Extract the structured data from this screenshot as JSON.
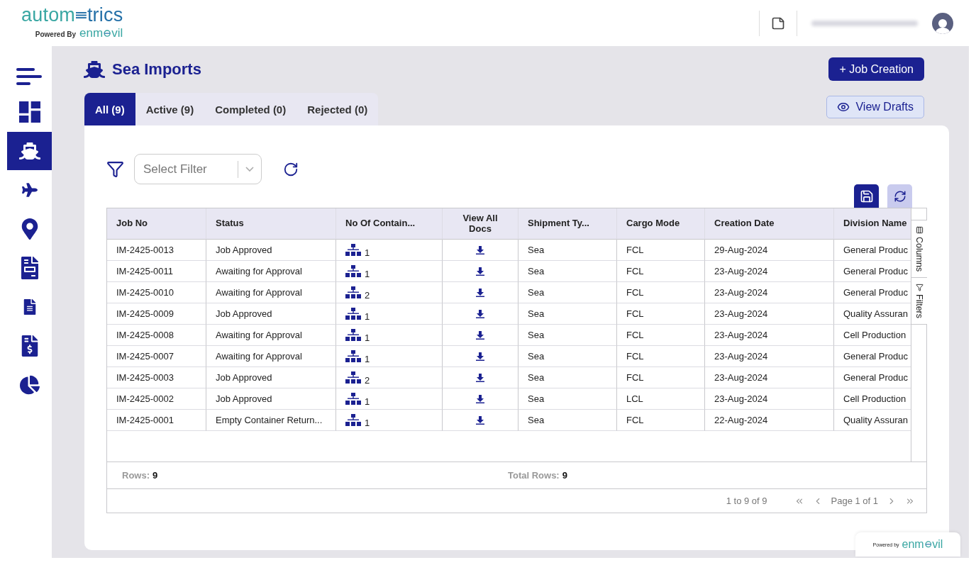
{
  "header": {
    "logo": {
      "left": "autom",
      "right": "trics"
    },
    "powered_by": {
      "label": "Powered By",
      "brand_left": "enm",
      "brand_right": "vil"
    }
  },
  "sidebar": {
    "items": [
      {
        "kind": "dashboard",
        "selected": false
      },
      {
        "kind": "ship",
        "selected": true
      },
      {
        "kind": "plane",
        "selected": false
      },
      {
        "kind": "pin",
        "selected": false
      },
      {
        "kind": "sheet",
        "selected": false
      },
      {
        "kind": "document",
        "selected": false
      },
      {
        "kind": "invoice",
        "selected": false
      },
      {
        "kind": "report",
        "selected": false
      }
    ]
  },
  "page": {
    "title": "Sea Imports",
    "job_creation": "+ Job Creation",
    "view_drafts": "View Drafts"
  },
  "tabs": [
    {
      "label": "All (9)",
      "selected": true
    },
    {
      "label": "Active (9)",
      "selected": false
    },
    {
      "label": "Completed (0)",
      "selected": false
    },
    {
      "label": "Rejected (0)",
      "selected": false
    }
  ],
  "filter": {
    "placeholder": "Select Filter"
  },
  "table": {
    "columns": [
      "Job No",
      "Status",
      "No Of Contain...",
      "View All Docs",
      "Shipment Ty...",
      "Cargo Mode",
      "Creation Date",
      "Division Name"
    ],
    "rows": [
      {
        "job_no": "IM-2425-0013",
        "status": "Job Approved",
        "containers": "1",
        "shipment_type": "Sea",
        "cargo_mode": "FCL",
        "creation_date": "29-Aug-2024",
        "division": "General Produc"
      },
      {
        "job_no": "IM-2425-0011",
        "status": "Awaiting for Approval",
        "containers": "1",
        "shipment_type": "Sea",
        "cargo_mode": "FCL",
        "creation_date": "23-Aug-2024",
        "division": "General Produc"
      },
      {
        "job_no": "IM-2425-0010",
        "status": "Awaiting for Approval",
        "containers": "2",
        "shipment_type": "Sea",
        "cargo_mode": "FCL",
        "creation_date": "23-Aug-2024",
        "division": "General Produc"
      },
      {
        "job_no": "IM-2425-0009",
        "status": "Job Approved",
        "containers": "1",
        "shipment_type": "Sea",
        "cargo_mode": "FCL",
        "creation_date": "23-Aug-2024",
        "division": "Quality Assuran"
      },
      {
        "job_no": "IM-2425-0008",
        "status": "Awaiting for Approval",
        "containers": "1",
        "shipment_type": "Sea",
        "cargo_mode": "FCL",
        "creation_date": "23-Aug-2024",
        "division": "Cell Production"
      },
      {
        "job_no": "IM-2425-0007",
        "status": "Awaiting for Approval",
        "containers": "1",
        "shipment_type": "Sea",
        "cargo_mode": "FCL",
        "creation_date": "23-Aug-2024",
        "division": "General Produc"
      },
      {
        "job_no": "IM-2425-0003",
        "status": "Job Approved",
        "containers": "2",
        "shipment_type": "Sea",
        "cargo_mode": "FCL",
        "creation_date": "23-Aug-2024",
        "division": "General Produc"
      },
      {
        "job_no": "IM-2425-0002",
        "status": "Job Approved",
        "containers": "1",
        "shipment_type": "Sea",
        "cargo_mode": "LCL",
        "creation_date": "23-Aug-2024",
        "division": "Cell Production"
      },
      {
        "job_no": "IM-2425-0001",
        "status": "Empty Container Return...",
        "containers": "1",
        "shipment_type": "Sea",
        "cargo_mode": "FCL",
        "creation_date": "22-Aug-2024",
        "division": "Quality Assuran"
      }
    ]
  },
  "side_panel": [
    "Columns",
    "Filters"
  ],
  "summary": {
    "rows_label": "Rows:",
    "rows": "9",
    "total_label": "Total Rows:",
    "total": "9"
  },
  "pagination": {
    "range": "1 to 9 of 9",
    "page": "Page 1 of 1"
  },
  "footer_badge": {
    "label": "Powered by",
    "brand_left": "enm",
    "brand_right": "vil"
  }
}
